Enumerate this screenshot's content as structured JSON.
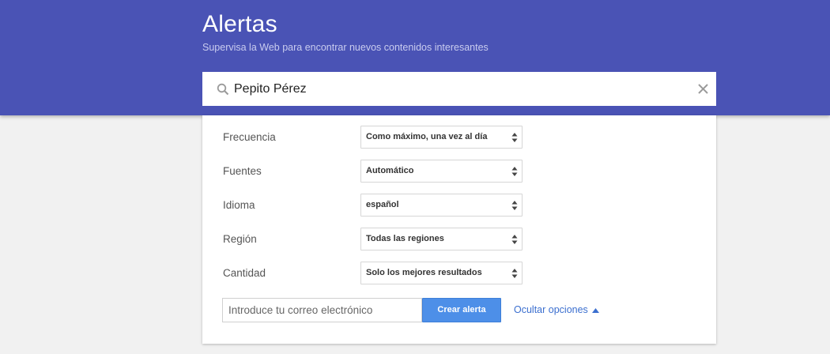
{
  "header": {
    "title": "Alertas",
    "subtitle": "Supervisa la Web para encontrar nuevos contenidos interesantes",
    "bg_color": "#4a53b5"
  },
  "search": {
    "value": "Pepito Pérez",
    "icon": "search-icon",
    "clear_icon": "close-icon"
  },
  "options": [
    {
      "label": "Frecuencia",
      "value": "Como máximo, una vez al día"
    },
    {
      "label": "Fuentes",
      "value": "Automático"
    },
    {
      "label": "Idioma",
      "value": "español"
    },
    {
      "label": "Región",
      "value": "Todas las regiones"
    },
    {
      "label": "Cantidad",
      "value": "Solo los mejores resultados"
    }
  ],
  "email": {
    "placeholder": "Introduce tu correo electrónico"
  },
  "actions": {
    "create_label": "Crear alerta",
    "hide_options_label": "Ocultar opciones",
    "accent_color": "#4d8fe8",
    "link_color": "#3b6fcf"
  }
}
